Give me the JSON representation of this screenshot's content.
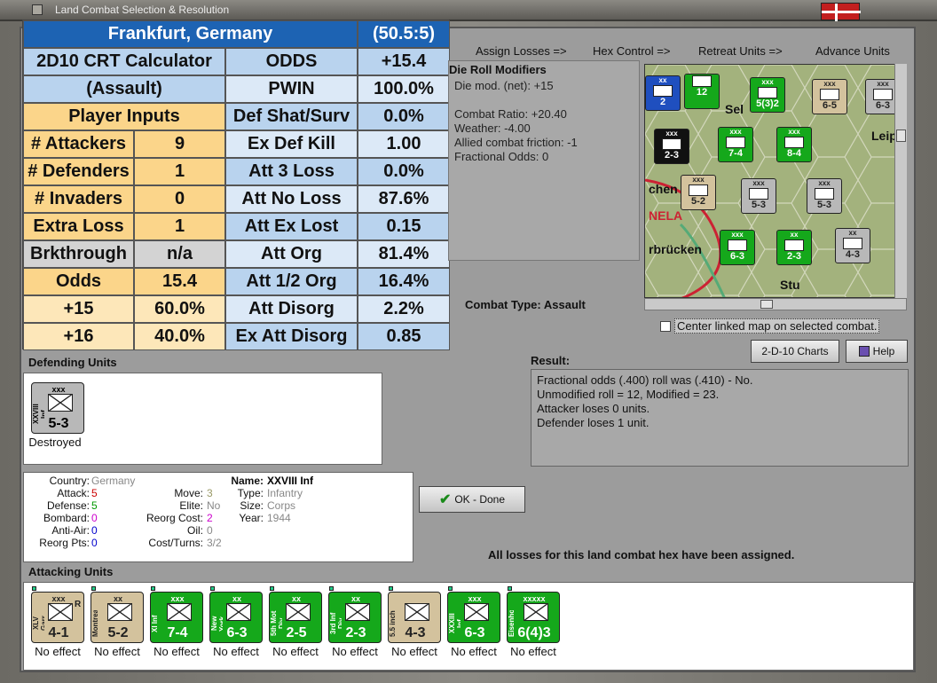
{
  "window": {
    "title": "Land Combat Selection & Resolution"
  },
  "calc": {
    "location": "Frankfurt, Germany",
    "coords": "(50.5:5)",
    "title1": "2D10 CRT Calculator",
    "title2": "(Assault)",
    "player_inputs": "Player Inputs",
    "inputs": [
      {
        "label": "# Attackers",
        "value": "9"
      },
      {
        "label": "# Defenders",
        "value": "1"
      },
      {
        "label": "# Invaders",
        "value": "0"
      },
      {
        "label": "Extra Loss",
        "value": "1"
      },
      {
        "label": "Brkthrough",
        "value": "n/a"
      },
      {
        "label": "Odds",
        "value": "15.4"
      },
      {
        "label": "+15",
        "value": "60.0%"
      },
      {
        "label": "+16",
        "value": "40.0%"
      }
    ],
    "results": [
      {
        "label": "ODDS",
        "value": "+15.4"
      },
      {
        "label": "PWIN",
        "value": "100.0%"
      },
      {
        "label": "Def Shat/Surv",
        "value": "0.0%"
      },
      {
        "label": "Ex Def Kill",
        "value": "1.00"
      },
      {
        "label": "Att 3 Loss",
        "value": "0.0%"
      },
      {
        "label": "Att No Loss",
        "value": "87.6%"
      },
      {
        "label": "Att Ex Lost",
        "value": "0.15"
      },
      {
        "label": "Att Org",
        "value": "81.4%"
      },
      {
        "label": "Att 1/2 Org",
        "value": "16.4%"
      },
      {
        "label": "Att Disorg",
        "value": "2.2%"
      },
      {
        "label": "Ex Att Disorg",
        "value": "0.85"
      }
    ]
  },
  "toolbar": {
    "assign_losses": "Assign Losses =>",
    "hex_control": "Hex Control =>",
    "retreat_units": "Retreat Units =>",
    "advance_units": "Advance Units"
  },
  "modifiers": {
    "title": "Die Roll Modifiers",
    "lines": [
      "Die mod. (net): +15",
      "",
      "Combat Ratio: +20.40",
      "Weather: -4.00",
      "Allied combat friction: -1",
      "Fractional Odds: 0"
    ]
  },
  "map": {
    "labels": [
      "Leip",
      "chen",
      "NELA",
      "rbrücken",
      "Stu",
      "Sel"
    ],
    "counters": [
      {
        "size": "xx",
        "stats": "2",
        "color": "#1f4fbf"
      },
      {
        "size": "",
        "stats": "12",
        "color": "#15a81b"
      },
      {
        "size": "xxx",
        "stats": "5(3)2",
        "color": "#15a81b"
      },
      {
        "size": "xxx",
        "stats": "6-5",
        "color": "#d3c29d"
      },
      {
        "size": "xxx",
        "stats": "6-3",
        "color": "#b8b8b8"
      },
      {
        "size": "xxx",
        "stats": "2-3",
        "color": "#111111"
      },
      {
        "size": "xxx",
        "stats": "7-4",
        "color": "#15a81b"
      },
      {
        "size": "xxx",
        "stats": "8-4",
        "color": "#15a81b"
      },
      {
        "size": "xxx",
        "stats": "5-2",
        "color": "#d3c29d"
      },
      {
        "size": "xxx",
        "stats": "5-3",
        "color": "#b8b8b8"
      },
      {
        "size": "xxx",
        "stats": "5-3",
        "color": "#b8b8b8"
      },
      {
        "size": "xxx",
        "stats": "6-3",
        "color": "#15a81b"
      },
      {
        "size": "xx",
        "stats": "2-3",
        "color": "#15a81b"
      },
      {
        "size": "xx",
        "stats": "4-3",
        "color": "#b8b8b8"
      }
    ]
  },
  "center_linked": "Center linked map on selected combat.",
  "buttons": {
    "charts": "2-D-10 Charts",
    "help": "Help",
    "ok": "OK - Done"
  },
  "combat_type": {
    "label": "Combat Type:",
    "value": "Assault"
  },
  "result": {
    "label": "Result:",
    "lines": [
      "Fractional odds (.400) roll was (.410)  - No.",
      "Unmodified roll = 12, Modified = 23.",
      "Attacker loses 0 units.",
      "Defender loses 1 unit."
    ]
  },
  "defending": {
    "label": "Defending Units",
    "units": [
      {
        "size": "xxx",
        "name": "XXVIII Inf",
        "stats": "5-3",
        "status": "Destroyed"
      }
    ]
  },
  "info": {
    "country_label": "Country:",
    "country": "Germany",
    "attack_label": "Attack:",
    "attack": "5",
    "defense_label": "Defense:",
    "defense": "5",
    "bombard_label": "Bombard:",
    "bombard": "0",
    "antiair_label": "Anti-Air:",
    "antiair": "0",
    "reorg_label": "Reorg Pts:",
    "reorg": "0",
    "move_label": "Move:",
    "move": "3",
    "elite_label": "Elite:",
    "elite": "No",
    "reorgcost_label": "Reorg Cost:",
    "reorgcost": "2",
    "oil_label": "Oil:",
    "oil": "0",
    "cost_label": "Cost/Turns:",
    "cost": "3/2",
    "name_label": "Name:",
    "name": "XXVIII Inf",
    "type_label": "Type:",
    "type": "Infantry",
    "size_label": "Size:",
    "size": "Corps",
    "year_label": "Year:",
    "year": "1944"
  },
  "losses_msg": "All losses for this land combat hex have been assigned.",
  "attacking": {
    "label": "Attacking Units",
    "units": [
      {
        "size": "xxx",
        "name": "XLV Garr",
        "stats": "4-1",
        "sub": "R",
        "status": "No effect",
        "color": "#d3c29d"
      },
      {
        "size": "xx",
        "name": "Montreal",
        "stats": "5-2",
        "sub": "",
        "status": "No effect",
        "color": "#d3c29d"
      },
      {
        "size": "xxx",
        "name": "XI Inf",
        "stats": "7-4",
        "sub": "",
        "status": "No effect",
        "color": "#15a81b"
      },
      {
        "size": "xx",
        "name": "New York",
        "stats": "6-3",
        "sub": "",
        "status": "No effect",
        "color": "#15a81b"
      },
      {
        "size": "xx",
        "name": "5th Mot Div",
        "stats": "2-5",
        "sub": "",
        "status": "No effect",
        "color": "#15a81b"
      },
      {
        "size": "xx",
        "name": "3rd Inf Div",
        "stats": "2-3",
        "sub": "",
        "status": "No effect",
        "color": "#15a81b"
      },
      {
        "size": "",
        "name": "5.5 inch",
        "stats": "4-3",
        "sub": "",
        "status": "No effect",
        "color": "#d3c29d"
      },
      {
        "size": "xxx",
        "name": "XXXIII Inf",
        "stats": "6-3",
        "sub": "",
        "status": "No effect",
        "color": "#15a81b"
      },
      {
        "size": "xxxxx",
        "name": "Eisenhower",
        "stats": "6(4)3",
        "sub": "",
        "status": "No effect",
        "color": "#15a81b"
      }
    ]
  }
}
